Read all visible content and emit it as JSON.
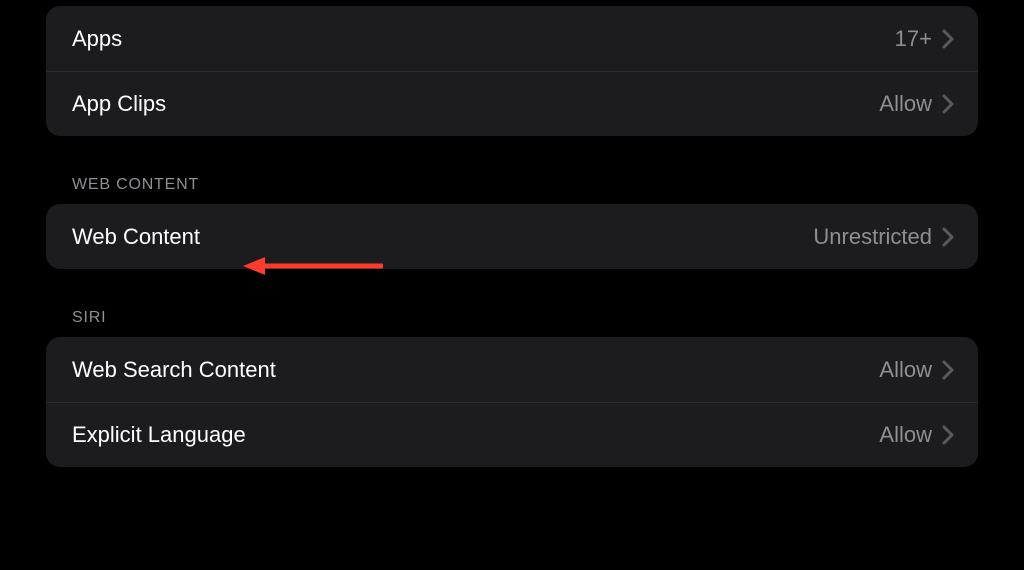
{
  "topGroup": {
    "items": [
      {
        "label": "Apps",
        "value": "17+"
      },
      {
        "label": "App Clips",
        "value": "Allow"
      }
    ]
  },
  "webContentSection": {
    "header": "WEB CONTENT",
    "items": [
      {
        "label": "Web Content",
        "value": "Unrestricted"
      }
    ]
  },
  "siriSection": {
    "header": "SIRI",
    "items": [
      {
        "label": "Web Search Content",
        "value": "Allow"
      },
      {
        "label": "Explicit Language",
        "value": "Allow"
      }
    ]
  },
  "colors": {
    "annotationArrow": "#ff3b30"
  }
}
